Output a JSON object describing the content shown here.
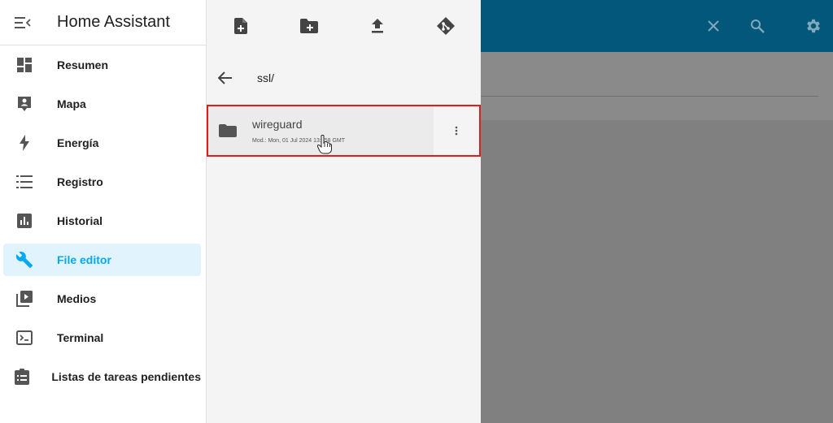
{
  "sidebar": {
    "title": "Home Assistant",
    "items": [
      {
        "label": "Resumen",
        "icon": "dashboard-icon"
      },
      {
        "label": "Mapa",
        "icon": "map-account-icon"
      },
      {
        "label": "Energía",
        "icon": "lightning-bolt-icon"
      },
      {
        "label": "Registro",
        "icon": "list-icon"
      },
      {
        "label": "Historial",
        "icon": "chart-box-icon"
      },
      {
        "label": "File editor",
        "icon": "wrench-icon",
        "active": true
      },
      {
        "label": "Medios",
        "icon": "play-box-multiple-icon"
      },
      {
        "label": "Terminal",
        "icon": "console-icon"
      },
      {
        "label": "Listas de tareas pendientes",
        "icon": "clipboard-list-icon"
      }
    ]
  },
  "file_browser": {
    "path": "ssl/",
    "entries": [
      {
        "name": "wireguard",
        "modified": "Mod.: Mon, 01 Jul 2024 13:  :58 GMT",
        "type": "folder"
      }
    ]
  },
  "colors": {
    "topbar": "#03577a",
    "accent": "#03a9f4",
    "highlight_border": "#e31b1b"
  }
}
